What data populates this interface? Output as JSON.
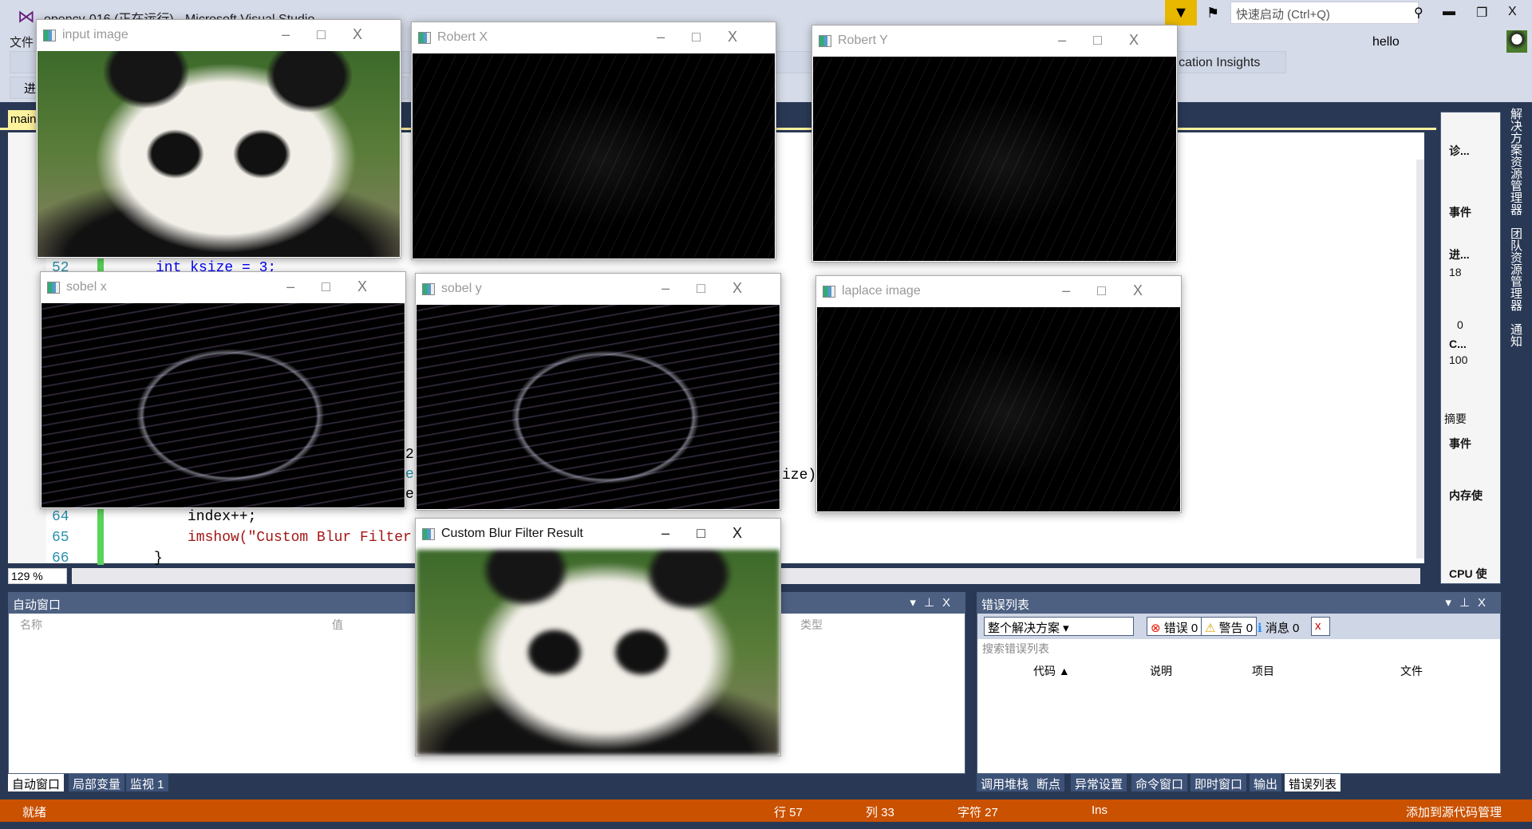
{
  "app": {
    "title": "opencv-016 (正在运行) - Microsoft Visual Studio",
    "quick_launch": "快速启动 (Ctrl+Q)",
    "user": "hello",
    "menu_first": "文件",
    "toolbar_row2": "进",
    "insights": "lication Insights",
    "doc_tab": "main"
  },
  "editor": {
    "zoom": "129 %",
    "lines": [
      {
        "num": "52",
        "code": "int ksize = 3;"
      },
      {
        "num": "64",
        "code": "index++;"
      },
      {
        "num": "65",
        "code": "imshow(\"Custom Blur Filter"
      },
      {
        "num": "66",
        "code": "}"
      }
    ],
    "fragments": [
      "2",
      "e",
      "e",
      "ize)"
    ]
  },
  "windows": [
    {
      "title": "input image"
    },
    {
      "title": "Robert X"
    },
    {
      "title": "Robert Y"
    },
    {
      "title": "sobel x"
    },
    {
      "title": "sobel y"
    },
    {
      "title": "laplace image"
    },
    {
      "title": "Custom Blur Filter Result"
    }
  ],
  "autos": {
    "title": "自动窗口",
    "cols": [
      "名称",
      "值",
      "类型"
    ],
    "tabs": [
      "自动窗口",
      "局部变量",
      "监视 1"
    ]
  },
  "errors": {
    "title": "错误列表",
    "scope": "整个解决方案",
    "errors": "错误 0",
    "warnings": "警告 0",
    "messages": "消息 0",
    "search_placeholder": "搜索错误列表",
    "cols": [
      "代码",
      "说明",
      "项目",
      "文件"
    ],
    "tabs": [
      "调用堆栈",
      "断点",
      "异常设置",
      "命令窗口",
      "即时窗口",
      "输出",
      "错误列表"
    ]
  },
  "diag": {
    "items": [
      "诊...",
      "事件",
      "进...",
      "18",
      "0",
      "C...",
      "100",
      "摘要",
      "事件",
      "内存使",
      "CPU 使"
    ]
  },
  "side_tabs": [
    "解决方案资源管理器",
    "团队资源管理器",
    "通知"
  ],
  "status": {
    "ready": "就绪",
    "row": "行 57",
    "col": "列 33",
    "char": "字符 27",
    "ins": "Ins",
    "source": "添加到源代码管理"
  },
  "colors": {
    "status": "#ca5100",
    "frame": "#293955",
    "panel_head": "#4d6082"
  }
}
